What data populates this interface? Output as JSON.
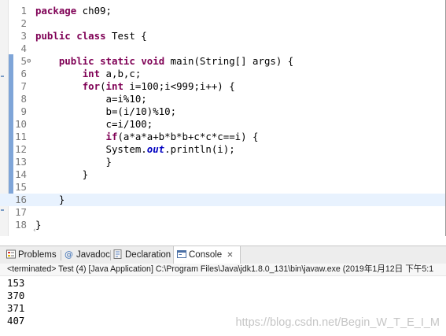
{
  "editor": {
    "lines": [
      {
        "n": "1",
        "tokens": [
          {
            "t": "package",
            "k": "kw"
          },
          {
            "t": " ch09;"
          }
        ]
      },
      {
        "n": "2",
        "tokens": []
      },
      {
        "n": "3",
        "tokens": [
          {
            "t": "public",
            "k": "kw"
          },
          {
            "t": " "
          },
          {
            "t": "class",
            "k": "kw"
          },
          {
            "t": " Test {"
          }
        ]
      },
      {
        "n": "4",
        "tokens": []
      },
      {
        "n": "5",
        "fold": "⊖",
        "tokens": [
          {
            "t": "    "
          },
          {
            "t": "public",
            "k": "kw"
          },
          {
            "t": " "
          },
          {
            "t": "static",
            "k": "kw"
          },
          {
            "t": " "
          },
          {
            "t": "void",
            "k": "kw"
          },
          {
            "t": " main(String[] args) {"
          }
        ]
      },
      {
        "n": "6",
        "tokens": [
          {
            "t": "        "
          },
          {
            "t": "int",
            "k": "kw"
          },
          {
            "t": " a,b,c;"
          }
        ]
      },
      {
        "n": "7",
        "tokens": [
          {
            "t": "        "
          },
          {
            "t": "for",
            "k": "kw"
          },
          {
            "t": "("
          },
          {
            "t": "int",
            "k": "kw"
          },
          {
            "t": " i=100;i<999;i++) {"
          }
        ]
      },
      {
        "n": "8",
        "tokens": [
          {
            "t": "            a=i%10;"
          }
        ]
      },
      {
        "n": "9",
        "tokens": [
          {
            "t": "            b=(i/10)%10;"
          }
        ]
      },
      {
        "n": "10",
        "tokens": [
          {
            "t": "            c=i/100;"
          }
        ]
      },
      {
        "n": "11",
        "tokens": [
          {
            "t": "            "
          },
          {
            "t": "if",
            "k": "kw"
          },
          {
            "t": "(a*a*a+b*b*b+c*c*c==i) {"
          }
        ]
      },
      {
        "n": "12",
        "tokens": [
          {
            "t": "            System."
          },
          {
            "t": "out",
            "k": "fld"
          },
          {
            "t": ".println(i);"
          }
        ]
      },
      {
        "n": "13",
        "tokens": [
          {
            "t": "            }"
          }
        ]
      },
      {
        "n": "14",
        "tokens": [
          {
            "t": "        }"
          }
        ]
      },
      {
        "n": "15",
        "tokens": []
      },
      {
        "n": "16",
        "tokens": [
          {
            "t": "    }"
          }
        ]
      },
      {
        "n": "17",
        "tokens": []
      },
      {
        "n": "18",
        "tokens": [
          {
            "t": "}"
          }
        ]
      }
    ],
    "highlight_line": "16",
    "hscroll_arrow": "‹"
  },
  "tabs": [
    {
      "label": "Problems",
      "icon": "problems-icon",
      "name": "tab-problems"
    },
    {
      "label": "Javadoc",
      "icon": "javadoc-icon",
      "name": "tab-javadoc"
    },
    {
      "label": "Declaration",
      "icon": "declaration-icon",
      "name": "tab-declaration"
    },
    {
      "label": "Console",
      "icon": "console-icon",
      "name": "tab-console",
      "active": true,
      "close": "✕"
    }
  ],
  "console": {
    "status": "<terminated> Test (4) [Java Application] C:\\Program Files\\Java\\jdk1.8.0_131\\bin\\javaw.exe (2019年1月12日 下午5:1",
    "output": [
      "153",
      "370",
      "371",
      "407"
    ]
  },
  "watermark": "https://blog.csdn.net/Begin_W_T_E_I_M",
  "colors": {
    "keyword": "#7f0055",
    "static_field": "#0000c0",
    "line_number": "#787878",
    "change_bar": "#7fa5d8",
    "current_line": "#e8f2fe"
  }
}
